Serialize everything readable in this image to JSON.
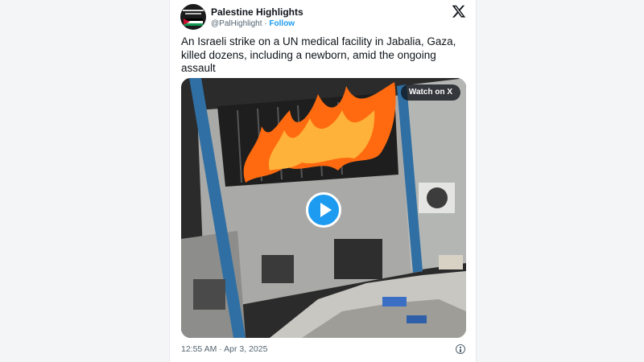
{
  "tweet": {
    "author_name": "Palestine Highlights",
    "handle": "@PalHighlight",
    "separator": "·",
    "follow_label": "Follow",
    "text": "An Israeli strike on a UN medical facility in Jabalia, Gaza, killed dozens, including a newborn, amid the ongoing assault",
    "timestamp": "12:55 AM · Apr 3, 2025"
  },
  "media": {
    "watch_label": "Watch on X"
  },
  "icons": {
    "platform_logo": "x-logo-icon",
    "play": "play-icon",
    "info": "info-icon"
  },
  "colors": {
    "accent": "#1d9bf0",
    "text": "#0f1419",
    "muted": "#536471",
    "fire": "#ff6a10"
  }
}
